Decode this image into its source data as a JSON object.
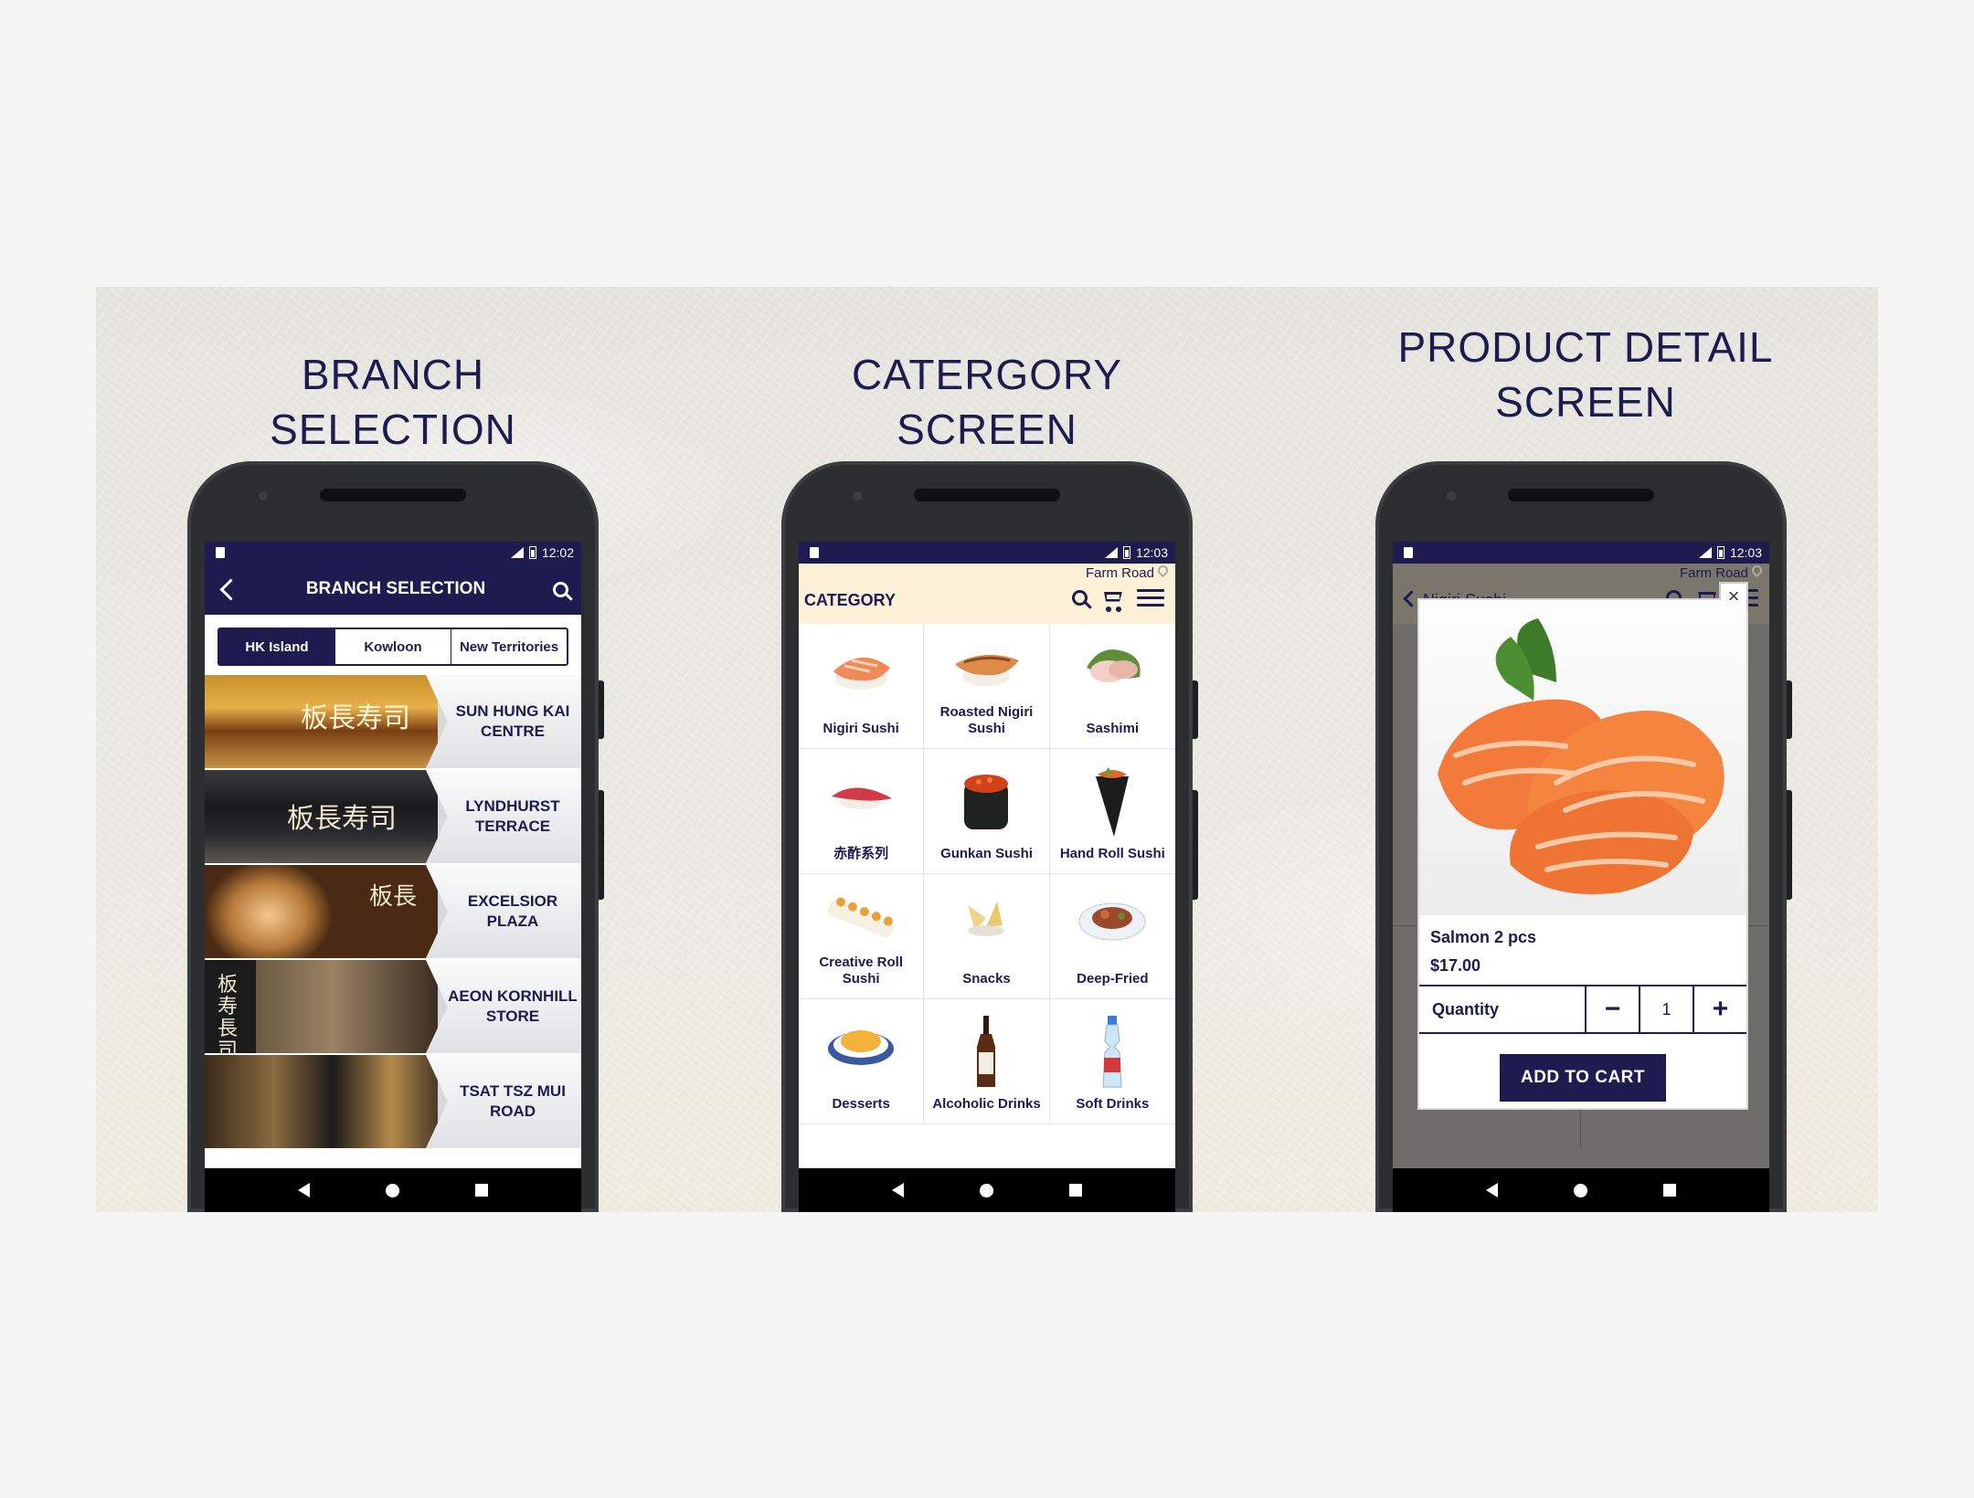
{
  "headings": {
    "branch": "BRANCH SELECTION",
    "category": "CATERGORY SCREEN",
    "product": "PRODUCT DETAIL SCREEN"
  },
  "phone1": {
    "status_time": "12:02",
    "header_title": "BRANCH SELECTION",
    "tabs": [
      "HK Island",
      "Kowloon",
      "New Territories"
    ],
    "active_tab": "HK Island",
    "branches": [
      {
        "name": "SUN HUNG KAI CENTRE"
      },
      {
        "name": "LYNDHURST TERRACE"
      },
      {
        "name": "EXCELSIOR PLAZA"
      },
      {
        "name": "AEON KORNHILL STORE"
      },
      {
        "name": "TSAT TSZ MUI ROAD"
      }
    ]
  },
  "phone2": {
    "status_time": "12:03",
    "location": "Farm Road",
    "title": "CATEGORY",
    "categories": [
      {
        "label": "Nigiri Sushi",
        "icon": "nigiri-icon"
      },
      {
        "label": "Roasted Nigiri Sushi",
        "icon": "roasted-nigiri-icon"
      },
      {
        "label": "Sashimi",
        "icon": "sashimi-icon"
      },
      {
        "label": "赤酢系列",
        "icon": "red-vinegar-icon"
      },
      {
        "label": "Gunkan Sushi",
        "icon": "gunkan-icon"
      },
      {
        "label": "Hand Roll Sushi",
        "icon": "hand-roll-icon"
      },
      {
        "label": "Creative Roll Sushi",
        "icon": "creative-roll-icon"
      },
      {
        "label": "Snacks",
        "icon": "snacks-icon"
      },
      {
        "label": "Deep-Fried",
        "icon": "deep-fried-icon"
      },
      {
        "label": "Desserts",
        "icon": "dessert-icon"
      },
      {
        "label": "Alcoholic Drinks",
        "icon": "sake-bottle-icon"
      },
      {
        "label": "Soft Drinks",
        "icon": "ramune-bottle-icon"
      }
    ]
  },
  "phone3": {
    "status_time": "12:03",
    "location": "Farm Road",
    "back_title": "Nigiri Sushi",
    "product_name": "Salmon 2 pcs",
    "price": "$17.00",
    "quantity_label": "Quantity",
    "quantity": "1",
    "minus": "−",
    "plus": "+",
    "add_to_cart": "ADD TO CART",
    "close": "×"
  },
  "colors": {
    "brand_navy": "#1d1b4f",
    "header_cream": "#fcf1d6"
  }
}
